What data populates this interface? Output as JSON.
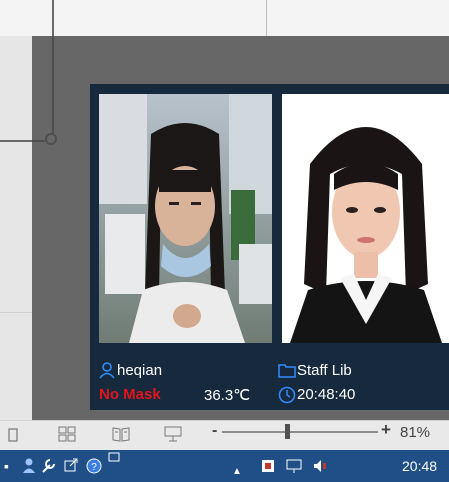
{
  "face_card": {
    "name": "heqian",
    "mask_status": "No Mask",
    "temperature": "36.3℃",
    "library": "Staff Lib",
    "time": "20:48:40"
  },
  "toolbar": {
    "zoom_minus": "-",
    "zoom_plus": "+",
    "zoom_value": "81%",
    "zoom_level_percent": 42
  },
  "taskbar": {
    "clock": "20:48"
  },
  "colors": {
    "alert": "#e2141c",
    "card_bg": "#172a3d",
    "icon_blue": "#2f8dff"
  }
}
